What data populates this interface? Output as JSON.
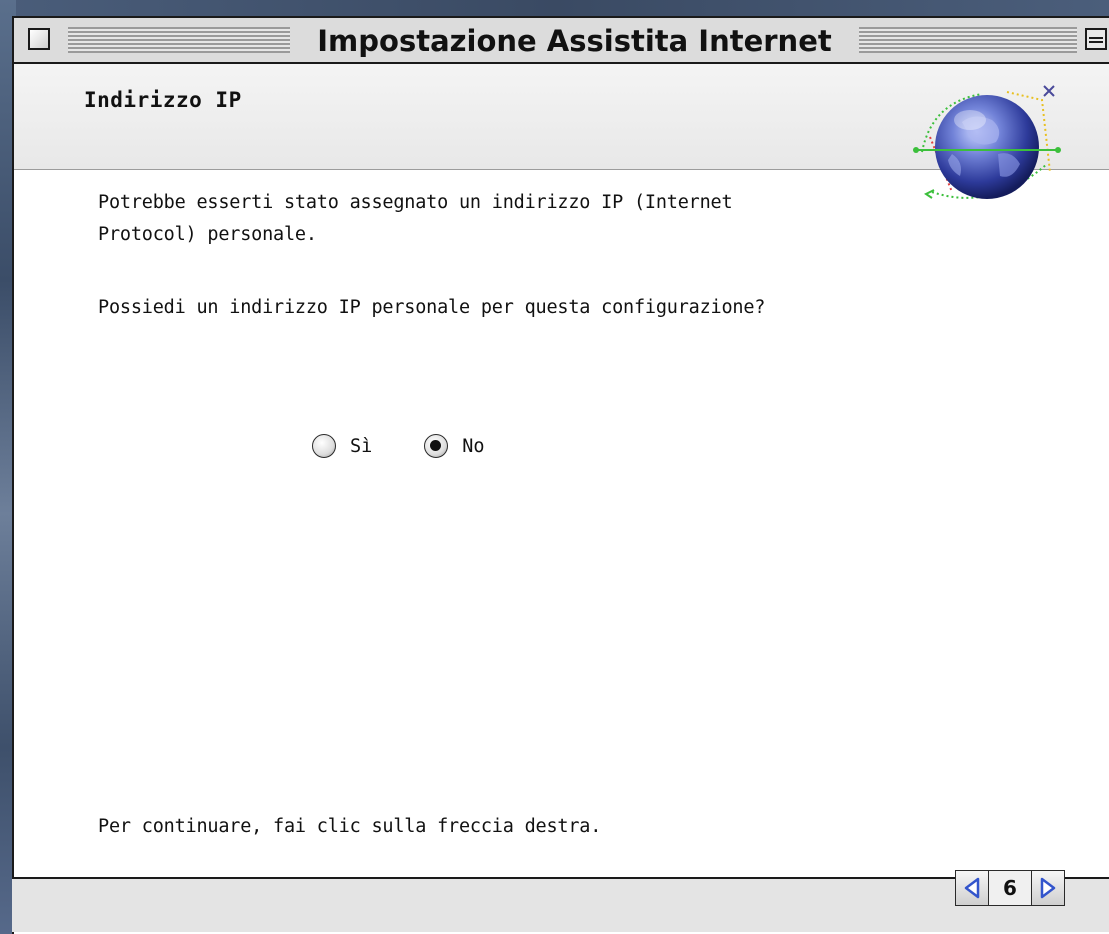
{
  "window": {
    "title": "Impostazione Assistita Internet"
  },
  "header": {
    "section_title": "Indirizzo IP",
    "icon": "internet-globe-icon"
  },
  "content": {
    "intro_line_1": "Potrebbe esserti stato assegnato un indirizzo IP (Internet",
    "intro_line_2": "Protocol) personale.",
    "question": "Possiedi un indirizzo IP personale per questa configurazione?",
    "options": [
      {
        "label": "Sì",
        "selected": false
      },
      {
        "label": "No",
        "selected": true
      }
    ],
    "instruction": "Per continuare, fai clic sulla freccia destra."
  },
  "navigation": {
    "page_number": "6",
    "back_icon": "left-arrow-icon",
    "forward_icon": "right-arrow-icon",
    "accent_color": "#3355cc"
  }
}
